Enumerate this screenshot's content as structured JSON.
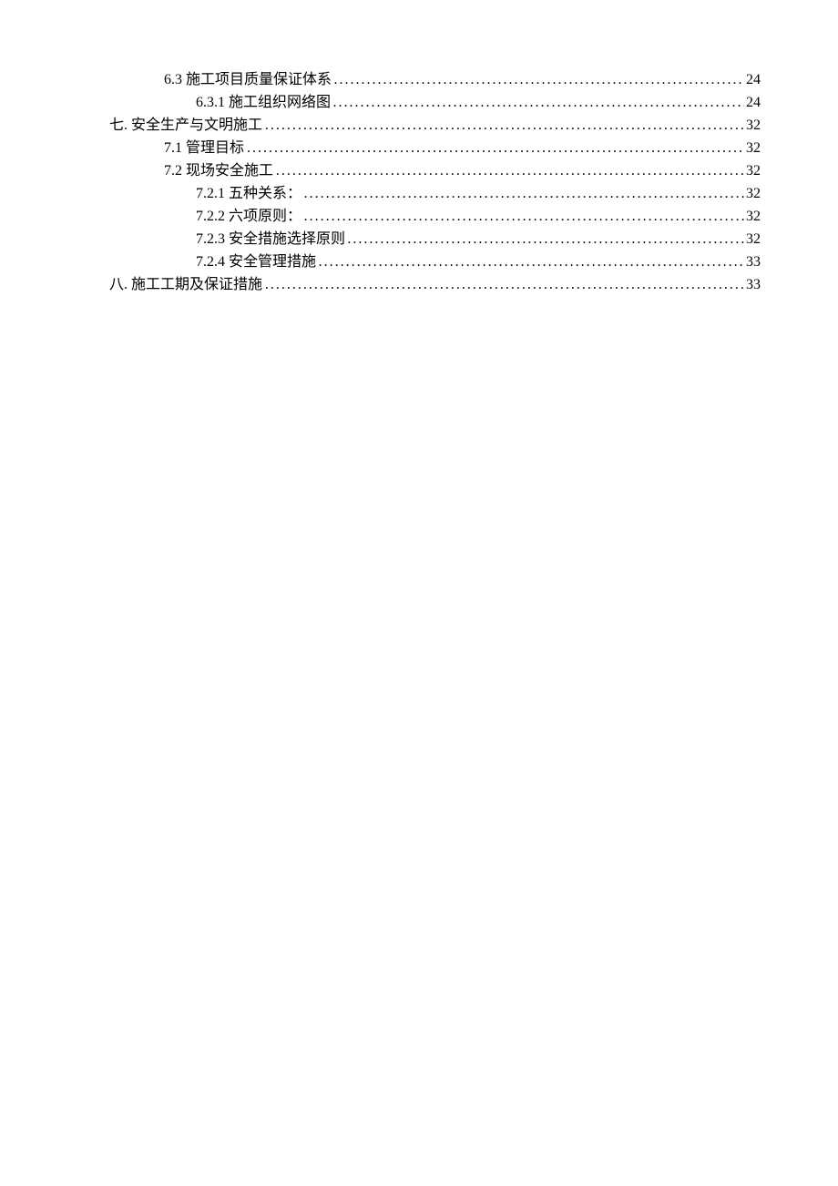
{
  "toc": [
    {
      "indent": 1,
      "label": "6.3  施工项目质量保证体系",
      "page": "24"
    },
    {
      "indent": 2,
      "label": "6.3.1 施工组织网络图",
      "page": "24"
    },
    {
      "indent": 0,
      "label": "七.  安全生产与文明施工",
      "page": "32"
    },
    {
      "indent": 1,
      "label": "7.1  管理目标",
      "page": "32"
    },
    {
      "indent": 1,
      "label": "7.2  现场安全施工",
      "page": "32"
    },
    {
      "indent": 2,
      "label": "7.2.1  五种关系：",
      "page": "32"
    },
    {
      "indent": 2,
      "label": "7.2.2  六项原则：",
      "page": "32"
    },
    {
      "indent": 2,
      "label": "7.2.3  安全措施选择原则",
      "page": "32"
    },
    {
      "indent": 2,
      "label": "7.2.4  安全管理措施",
      "page": "33"
    },
    {
      "indent": 0,
      "label": "八.  施工工期及保证措施",
      "page": "33"
    }
  ]
}
